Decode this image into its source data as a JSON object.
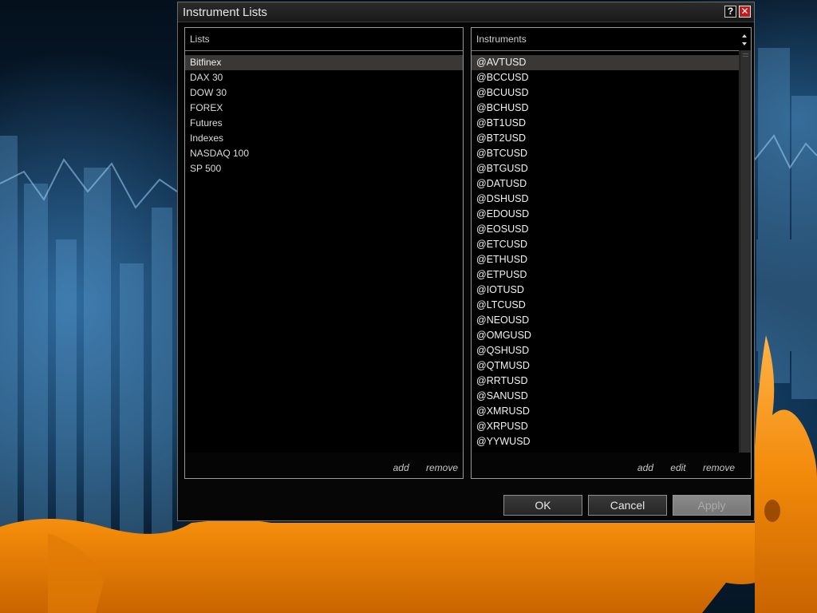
{
  "window": {
    "title": "Instrument Lists"
  },
  "titlebar": {
    "help_label": "?",
    "close_label": "✕"
  },
  "lists_panel": {
    "title": "Lists",
    "items": [
      "Bitfinex",
      "DAX 30",
      "DOW 30",
      "FOREX",
      "Futures",
      "Indexes",
      "NASDAQ 100",
      "SP 500"
    ],
    "selected": "Bitfinex",
    "add_label": "add",
    "remove_label": "remove"
  },
  "instruments_panel": {
    "title": "Instruments",
    "items": [
      "@AVTUSD",
      "@BCCUSD",
      "@BCUUSD",
      "@BCHUSD",
      "@BT1USD",
      "@BT2USD",
      "@BTCUSD",
      "@BTGUSD",
      "@DATUSD",
      "@DSHUSD",
      "@EDOUSD",
      "@EOSUSD",
      "@ETCUSD",
      "@ETHUSD",
      "@ETPUSD",
      "@IOTUSD",
      "@LTCUSD",
      "@NEOUSD",
      "@OMGUSD",
      "@QSHUSD",
      "@QTMUSD",
      "@RRTUSD",
      "@SANUSD",
      "@XMRUSD",
      "@XRPUSD",
      "@YYWUSD"
    ],
    "selected": "@AVTUSD",
    "add_label": "add",
    "edit_label": "edit",
    "remove_label": "remove"
  },
  "buttons": {
    "ok": "OK",
    "cancel": "Cancel",
    "apply": "Apply"
  },
  "colors": {
    "dialog_bg": "#060606",
    "selection": "#3a3836",
    "close_red": "#c21b1b",
    "bull_orange": "#f28a0a"
  }
}
